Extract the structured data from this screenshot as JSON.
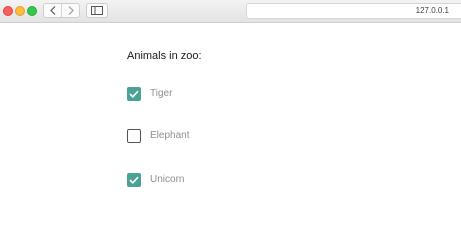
{
  "browser": {
    "url": "127.0.0.1"
  },
  "form": {
    "title": "Animals in zoo:",
    "options": [
      {
        "label": "Tiger",
        "checked": true
      },
      {
        "label": "Elephant",
        "checked": false
      },
      {
        "label": "Unicorn",
        "checked": true
      }
    ]
  },
  "colors": {
    "checkbox_checked": "#4aa196",
    "label_text": "#8f8f8f"
  }
}
